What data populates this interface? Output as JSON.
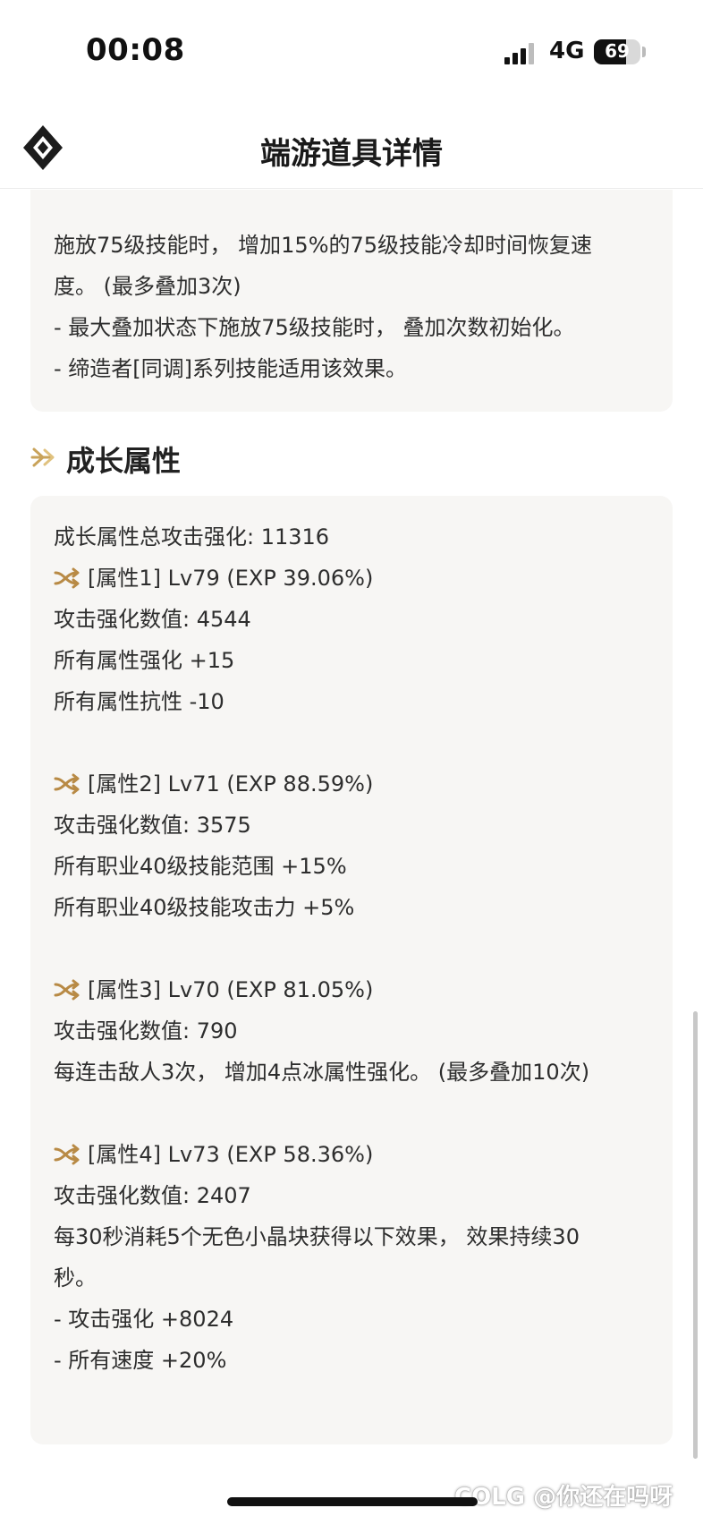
{
  "status_bar": {
    "time": "00:08",
    "network": "4G",
    "battery": "69",
    "battery_level": 0.69
  },
  "nav": {
    "title": "端游道具详情"
  },
  "effect_card": {
    "lines": [
      "施放75级技能时， 增加15%的75级技能冷却时间恢复速",
      "度。 (最多叠加3次)",
      "- 最大叠加状态下施放75级技能时， 叠加次数初始化。",
      "- 缔造者[同调]系列技能适用该效果。"
    ]
  },
  "growth_section": {
    "title": "成长属性"
  },
  "growth_card": {
    "total": "成长属性总攻击强化: 11316",
    "attr1": {
      "header": "[属性1] Lv79 (EXP 39.06%)",
      "lines": [
        "攻击强化数值:  4544",
        "所有属性强化 +15",
        "所有属性抗性 -10"
      ]
    },
    "attr2": {
      "header": "[属性2] Lv71 (EXP 88.59%)",
      "lines": [
        "攻击强化数值:  3575",
        "所有职业40级技能范围 +15%",
        "所有职业40级技能攻击力 +5%"
      ]
    },
    "attr3": {
      "header": "[属性3] Lv70 (EXP 81.05%)",
      "lines": [
        "攻击强化数值:  790",
        "每连击敌人3次， 增加4点冰属性强化。 (最多叠加10次)"
      ]
    },
    "attr4": {
      "header": "[属性4] Lv73 (EXP 58.36%)",
      "lines": [
        "攻击强化数值:  2407",
        "每30秒消耗5个无色小晶块获得以下效果， 效果持续30",
        "秒。",
        "- 攻击强化 +8024",
        "- 所有速度 +20%"
      ]
    }
  },
  "watermark": "COLG @你还在吗呀",
  "colors": {
    "card_bg": "#f7f6f4",
    "accent_gold": "#c9a35a",
    "text": "#2d2d2d"
  },
  "icons": {
    "logo": "diamond-logo-icon",
    "section": "double-arrow-icon",
    "attribute": "shuffle-icon"
  }
}
